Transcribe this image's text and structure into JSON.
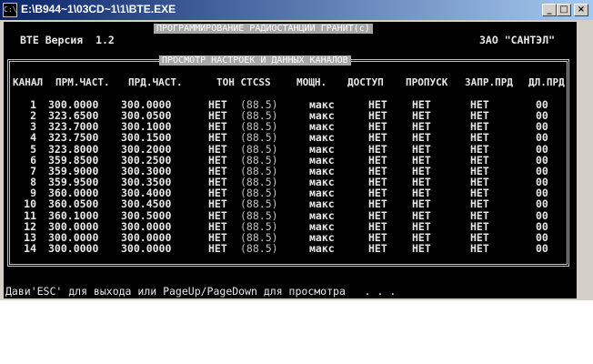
{
  "window": {
    "title": "E:\\B944~1\\03CD~1\\1\\BTE.EXE",
    "icon": "C:\\",
    "minimize": "_",
    "maximize": "□",
    "close": "×"
  },
  "app": {
    "banner_title": "ПРОГРАММИРОВАНИЕ РАДИОСТАНЦИИ ГРАНИТ(с)",
    "version": "BTE Версия  1.2",
    "company": "ЗАО \"САНТЭЛ\"",
    "section_title": "ПРОСМОТР НАСТРОЕК И ДАННЫХ КАНАЛОВ"
  },
  "columns": [
    "КАНАЛ",
    "ПРМ.ЧАСТ.",
    "ПРД.ЧАСТ.",
    "ТОН CTCSS",
    "МОЩН.",
    "ДОСТУП",
    "ПРОПУСК",
    "ЗАПР.ПРД",
    "ДЛ.ПРД"
  ],
  "channels": [
    {
      "ch": "1",
      "rx": "300.0000",
      "tx": "300.0000",
      "ton": "НЕТ",
      "ctcss": "(88.5)",
      "pwr": "макс",
      "access": "НЕТ",
      "skip": "НЕТ",
      "txinh": "НЕТ",
      "txlen": "00"
    },
    {
      "ch": "2",
      "rx": "323.6500",
      "tx": "300.0500",
      "ton": "НЕТ",
      "ctcss": "(88.5)",
      "pwr": "макс",
      "access": "НЕТ",
      "skip": "НЕТ",
      "txinh": "НЕТ",
      "txlen": "00"
    },
    {
      "ch": "3",
      "rx": "323.7000",
      "tx": "300.1000",
      "ton": "НЕТ",
      "ctcss": "(88.5)",
      "pwr": "макс",
      "access": "НЕТ",
      "skip": "НЕТ",
      "txinh": "НЕТ",
      "txlen": "00"
    },
    {
      "ch": "4",
      "rx": "323.7500",
      "tx": "300.1500",
      "ton": "НЕТ",
      "ctcss": "(88.5)",
      "pwr": "макс",
      "access": "НЕТ",
      "skip": "НЕТ",
      "txinh": "НЕТ",
      "txlen": "00"
    },
    {
      "ch": "5",
      "rx": "323.8000",
      "tx": "300.2000",
      "ton": "НЕТ",
      "ctcss": "(88.5)",
      "pwr": "макс",
      "access": "НЕТ",
      "skip": "НЕТ",
      "txinh": "НЕТ",
      "txlen": "00"
    },
    {
      "ch": "6",
      "rx": "359.8500",
      "tx": "300.2500",
      "ton": "НЕТ",
      "ctcss": "(88.5)",
      "pwr": "макс",
      "access": "НЕТ",
      "skip": "НЕТ",
      "txinh": "НЕТ",
      "txlen": "00"
    },
    {
      "ch": "7",
      "rx": "359.9000",
      "tx": "300.3000",
      "ton": "НЕТ",
      "ctcss": "(88.5)",
      "pwr": "макс",
      "access": "НЕТ",
      "skip": "НЕТ",
      "txinh": "НЕТ",
      "txlen": "00"
    },
    {
      "ch": "8",
      "rx": "359.9500",
      "tx": "300.3500",
      "ton": "НЕТ",
      "ctcss": "(88.5)",
      "pwr": "макс",
      "access": "НЕТ",
      "skip": "НЕТ",
      "txinh": "НЕТ",
      "txlen": "00"
    },
    {
      "ch": "9",
      "rx": "360.0000",
      "tx": "300.4000",
      "ton": "НЕТ",
      "ctcss": "(88.5)",
      "pwr": "макс",
      "access": "НЕТ",
      "skip": "НЕТ",
      "txinh": "НЕТ",
      "txlen": "00"
    },
    {
      "ch": "10",
      "rx": "360.0500",
      "tx": "300.4500",
      "ton": "НЕТ",
      "ctcss": "(88.5)",
      "pwr": "макс",
      "access": "НЕТ",
      "skip": "НЕТ",
      "txinh": "НЕТ",
      "txlen": "00"
    },
    {
      "ch": "11",
      "rx": "360.1000",
      "tx": "300.5000",
      "ton": "НЕТ",
      "ctcss": "(88.5)",
      "pwr": "макс",
      "access": "НЕТ",
      "skip": "НЕТ",
      "txinh": "НЕТ",
      "txlen": "00"
    },
    {
      "ch": "12",
      "rx": "300.0000",
      "tx": "300.0000",
      "ton": "НЕТ",
      "ctcss": "(88.5)",
      "pwr": "макс",
      "access": "НЕТ",
      "skip": "НЕТ",
      "txinh": "НЕТ",
      "txlen": "00"
    },
    {
      "ch": "13",
      "rx": "300.0000",
      "tx": "300.0000",
      "ton": "НЕТ",
      "ctcss": "(88.5)",
      "pwr": "макс",
      "access": "НЕТ",
      "skip": "НЕТ",
      "txinh": "НЕТ",
      "txlen": "00"
    },
    {
      "ch": "14",
      "rx": "300.0000",
      "tx": "300.0000",
      "ton": "НЕТ",
      "ctcss": "(88.5)",
      "pwr": "макс",
      "access": "НЕТ",
      "skip": "НЕТ",
      "txinh": "НЕТ",
      "txlen": "00"
    }
  ],
  "status_line": "Дави'ESC' для выхода или PageUp/PageDown для просмотра   . . .",
  "colors": {
    "titlebar_start": "#0a246a",
    "titlebar_end": "#a6caf0",
    "console_bg": "#000000",
    "console_text": "#c0c0c0",
    "banner_bg": "#a8a8a8"
  }
}
